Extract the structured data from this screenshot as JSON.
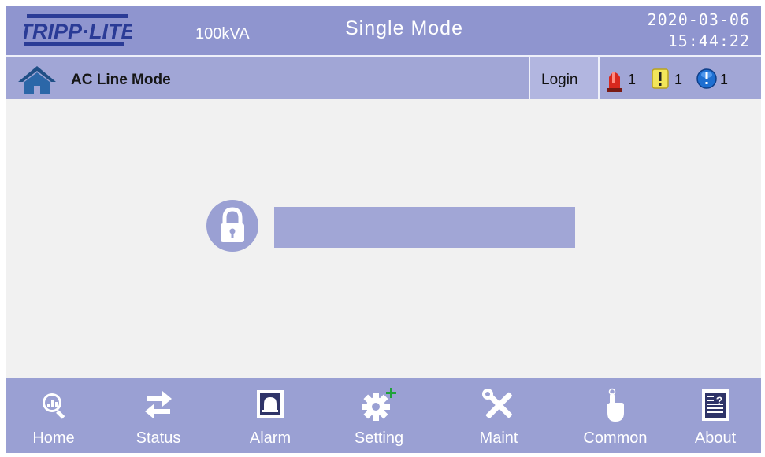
{
  "header": {
    "brand": "TRIPP·LITE",
    "rating": "100kVA",
    "mode": "Single Mode",
    "date": "2020-03-06",
    "time": "15:44:22"
  },
  "status": {
    "line_mode": "AC Line Mode",
    "login_label": "Login",
    "alarms": [
      {
        "icon": "red-beacon-icon",
        "count": "1"
      },
      {
        "icon": "yellow-warning-icon",
        "count": "1"
      },
      {
        "icon": "blue-info-icon",
        "count": "1"
      }
    ]
  },
  "main": {
    "lock_icon": "padlock-icon",
    "password_value": ""
  },
  "nav": [
    {
      "label": "Home",
      "icon": "home-magnifier-icon"
    },
    {
      "label": "Status",
      "icon": "swap-arrows-icon"
    },
    {
      "label": "Alarm",
      "icon": "alarm-bell-icon"
    },
    {
      "label": "Setting",
      "icon": "gear-plus-icon"
    },
    {
      "label": "Maint",
      "icon": "wrench-screwdriver-icon"
    },
    {
      "label": "Common",
      "icon": "hand-pointer-icon"
    },
    {
      "label": "About",
      "icon": "document-question-icon"
    }
  ],
  "colors": {
    "header_bg": "#8f95cf",
    "statusbar_bg": "#a1a6d6",
    "nav_bg": "#9aa0d3",
    "content_bg": "#f1f1f1",
    "brand_blue": "#2a3b96"
  }
}
